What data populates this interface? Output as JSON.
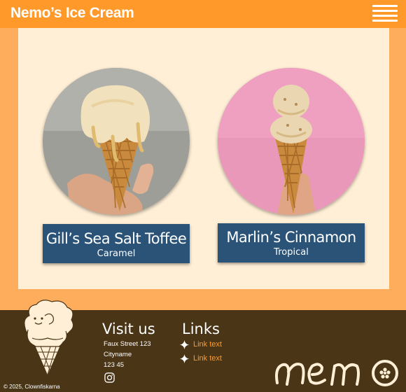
{
  "header": {
    "title": "Nemo’s Ice Cream",
    "menu_icon": "hamburger-menu-icon"
  },
  "products": [
    {
      "name": "Gill’s Sea Salt Toffee",
      "flavor": "Caramel",
      "image": "ice-cream-cone-photo-grey"
    },
    {
      "name": "Marlin’s Cinnamon",
      "flavor": "Tropical",
      "image": "ice-cream-cone-photo-pink"
    }
  ],
  "footer": {
    "visit_heading": "Visit us",
    "address": [
      "Faux Street 123",
      "Cityname",
      "123 45"
    ],
    "social_icon": "instagram-icon",
    "links_heading": "Links",
    "links": [
      "Link text",
      "Link text"
    ],
    "copyright": "© 2025, Clownfiskarna",
    "logo_text": "nemo"
  },
  "colors": {
    "header": "#ff9a2a",
    "page_background": "#fdad5c",
    "content_background": "#ffefd6",
    "product_label": "#2b5378",
    "footer_background": "#4a3517",
    "link": "#ff9a2a"
  }
}
